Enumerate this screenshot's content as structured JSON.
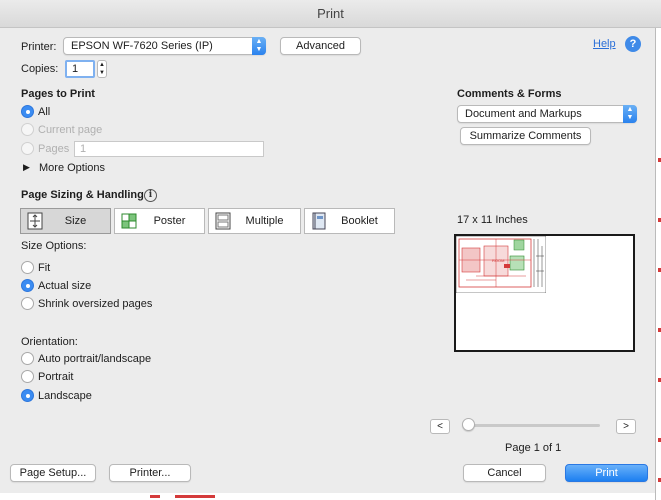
{
  "window": {
    "title": "Print"
  },
  "printer": {
    "label": "Printer:",
    "selected": "EPSON WF-7620 Series (IP)",
    "advanced_label": "Advanced",
    "help_label": "Help",
    "help_icon": "?"
  },
  "copies": {
    "label": "Copies:",
    "value": "1"
  },
  "pages_to_print": {
    "heading": "Pages to Print",
    "all_label": "All",
    "current_page_label": "Current page",
    "pages_label": "Pages",
    "pages_value": "1",
    "more_options_label": "More Options"
  },
  "comments_forms": {
    "heading": "Comments & Forms",
    "selected": "Document and Markups",
    "summarize_label": "Summarize Comments"
  },
  "sizing": {
    "heading": "Page Sizing & Handling",
    "info_icon": "i",
    "tabs": [
      {
        "label": "Size",
        "icon": "fit-page-icon"
      },
      {
        "label": "Poster",
        "icon": "poster-tiles-icon"
      },
      {
        "label": "Multiple",
        "icon": "multiple-pages-icon"
      },
      {
        "label": "Booklet",
        "icon": "booklet-icon"
      }
    ],
    "size_options_label": "Size Options:",
    "fit_label": "Fit",
    "actual_size_label": "Actual size",
    "shrink_label": "Shrink oversized pages",
    "selected": "Actual size"
  },
  "orientation": {
    "label": "Orientation:",
    "auto_label": "Auto portrait/landscape",
    "portrait_label": "Portrait",
    "landscape_label": "Landscape",
    "selected": "Landscape"
  },
  "preview": {
    "paper_size": "17 x 11 Inches",
    "page_info": "Page 1 of 1",
    "prev_icon": "<",
    "next_icon": ">"
  },
  "footer": {
    "page_setup_label": "Page Setup...",
    "printer_label": "Printer...",
    "cancel_label": "Cancel",
    "print_label": "Print"
  },
  "colors": {
    "accent": "#2a82ee",
    "markup_red": "#d43a3a",
    "window_bg": "#ececec"
  }
}
